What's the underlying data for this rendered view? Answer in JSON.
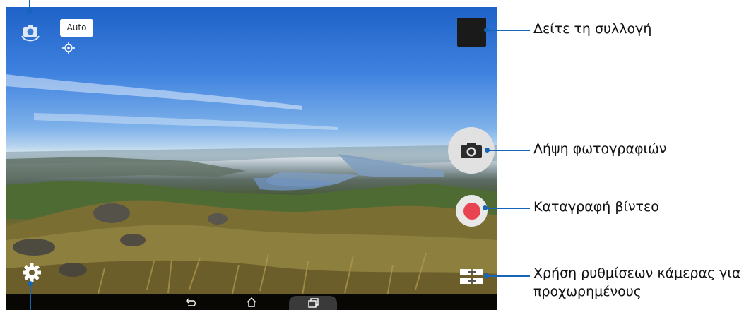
{
  "camera": {
    "scene_mode_badge": "Auto",
    "icons": {
      "switch_camera": "switch-camera-icon",
      "focus": "focus-crosshair-icon",
      "gallery": "gallery-thumbnail",
      "shutter": "camera-icon",
      "record": "record-dot-icon",
      "advanced": "advanced-settings-icon",
      "settings": "gear-icon"
    },
    "colors": {
      "record_red": "#e84350",
      "callout_blue": "#1565b8"
    }
  },
  "navbar": {
    "icons": [
      "back-icon",
      "home-icon",
      "recent-apps-icon"
    ]
  },
  "callouts": {
    "gallery": "Δείτε τη συλλογή",
    "photo": "Λήψη φωτογραφιών",
    "video": "Καταγραφή βίντεο",
    "advanced_line1": "Χρήση ρυθμίσεων κάμερας για",
    "advanced_line2": "προχωρημένους"
  }
}
